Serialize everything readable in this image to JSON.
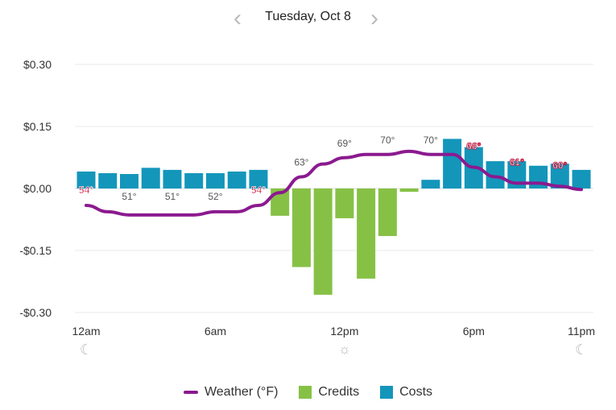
{
  "header": {
    "title": "Tuesday, Oct 8",
    "prev_icon": "chevron-left-icon",
    "next_icon": "chevron-right-icon"
  },
  "chart_data": {
    "type": "bar",
    "ylim": [
      -0.3,
      0.3
    ],
    "yticks": [
      "$0.30",
      "$0.15",
      "$0.00",
      "-$0.15",
      "-$0.30"
    ],
    "ytick_values": [
      0.3,
      0.15,
      0,
      -0.15,
      -0.3
    ],
    "xticks": [
      {
        "hour": 0,
        "label": "12am",
        "icon": "moon-icon"
      },
      {
        "hour": 6,
        "label": "6am"
      },
      {
        "hour": 12,
        "label": "12pm",
        "icon": "sun-icon"
      },
      {
        "hour": 18,
        "label": "6pm"
      },
      {
        "hour": 23,
        "label": "11pm",
        "icon": "moon-icon"
      }
    ],
    "grid": true,
    "legend": "bottom",
    "colors": {
      "weather": "#8b1a8f",
      "credits": "#86c146",
      "costs": "#1396ba"
    },
    "series": [
      {
        "name": "Weather (°F)",
        "type": "line",
        "values": [
          54,
          52,
          51,
          51,
          51,
          51,
          52,
          52,
          54,
          58,
          63,
          67,
          69,
          70,
          70,
          71,
          70,
          70,
          66,
          63,
          61,
          61,
          60,
          59
        ]
      },
      {
        "name": "Credits",
        "type": "bar",
        "values": [
          0,
          0,
          0,
          0,
          0,
          0,
          0,
          0,
          0,
          -0.066,
          -0.19,
          -0.257,
          -0.072,
          -0.218,
          -0.115,
          -0.008,
          0,
          0,
          0,
          0,
          0,
          0,
          0,
          0
        ]
      },
      {
        "name": "Costs",
        "type": "bar",
        "values": [
          0.041,
          0.037,
          0.035,
          0.05,
          0.045,
          0.037,
          0.037,
          0.041,
          0.045,
          0,
          0,
          0,
          0,
          0,
          0,
          0,
          0.021,
          0.12,
          0.1,
          0.066,
          0.066,
          0.055,
          0.06,
          0.045
        ]
      }
    ],
    "temp_labels": [
      {
        "hour": 0,
        "label": "54°",
        "hl": true
      },
      {
        "hour": 2,
        "label": "51°"
      },
      {
        "hour": 4,
        "label": "51°"
      },
      {
        "hour": 6,
        "label": "52°"
      },
      {
        "hour": 8,
        "label": "54°",
        "hl": true
      },
      {
        "hour": 10,
        "label": "63°"
      },
      {
        "hour": 12,
        "label": "69°"
      },
      {
        "hour": 14,
        "label": "70°"
      },
      {
        "hour": 16,
        "label": "70°"
      },
      {
        "hour": 18,
        "label": "66°",
        "hl2": true
      },
      {
        "hour": 20,
        "label": "61°",
        "hl2": true
      },
      {
        "hour": 22,
        "label": "60°",
        "hl2": true
      }
    ]
  },
  "legend": {
    "weather": "Weather (°F)",
    "credits": "Credits",
    "costs": "Costs"
  }
}
